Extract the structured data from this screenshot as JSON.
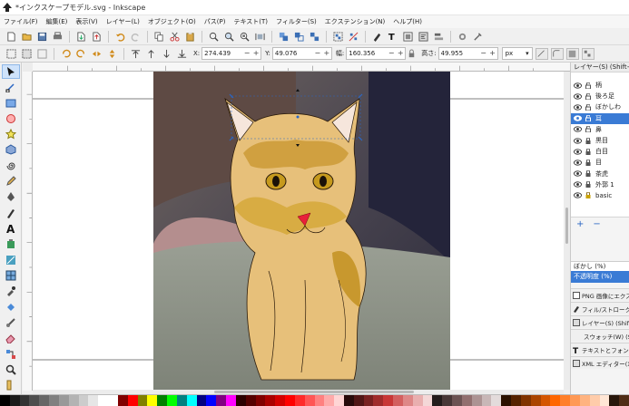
{
  "window": {
    "title": "*インクスケープモデル.svg - Inkscape"
  },
  "menu": [
    "ファイル(F)",
    "編集(E)",
    "表示(V)",
    "レイヤー(L)",
    "オブジェクト(O)",
    "パス(P)",
    "テキスト(T)",
    "フィルター(S)",
    "エクステンション(N)",
    "ヘルプ(H)"
  ],
  "toolbar": {
    "x_label": "X:",
    "x_value": "274.439",
    "y_label": "Y:",
    "y_value": "49.076",
    "w_label": "幅:",
    "w_value": "160.356",
    "h_label": "高さ:",
    "h_value": "49.955",
    "unit": "px"
  },
  "layers_panel": {
    "title": "レイヤー(S) (Shift+Ctrl+L)",
    "layers": [
      {
        "name": "柄",
        "selected": false
      },
      {
        "name": "後ろ足",
        "selected": false
      },
      {
        "name": "ぼかしわ",
        "selected": false
      },
      {
        "name": "耳",
        "selected": true
      },
      {
        "name": "鼻",
        "selected": false
      },
      {
        "name": "黒目",
        "selected": false
      },
      {
        "name": "白目",
        "selected": false
      },
      {
        "name": "目",
        "selected": false
      },
      {
        "name": "茶虎",
        "selected": false
      },
      {
        "name": "外郭 1",
        "selected": false
      },
      {
        "name": "basic",
        "selected": false
      }
    ],
    "add_label": "+",
    "remove_label": "−",
    "blur_label": "ぼかし (%)",
    "opacity_label": "不透明度 (%)"
  },
  "dock_tabs": [
    "PNG 画像にエクスポート",
    "フィル/ストローク(F)",
    "レイヤー(S) (Shift+Ctrl+L)",
    "スウォッチ(W) (Shift+Ctrl+W)",
    "テキストとフォント(T)",
    "XML エディター(X) (Ctrl+Shift+X)"
  ],
  "palette_colors": [
    "#000000",
    "#1a1a1a",
    "#333333",
    "#4d4d4d",
    "#666666",
    "#808080",
    "#999999",
    "#b3b3b3",
    "#cccccc",
    "#e6e6e6",
    "#ffffff",
    "#ffffff",
    "#800000",
    "#ff0000",
    "#808000",
    "#ffff00",
    "#008000",
    "#00ff00",
    "#008080",
    "#00ffff",
    "#000080",
    "#0000ff",
    "#800080",
    "#ff00ff",
    "#2b0000",
    "#550000",
    "#800000",
    "#aa0000",
    "#d40000",
    "#ff0000",
    "#ff2a2a",
    "#ff5555",
    "#ff8080",
    "#ffaaaa",
    "#ffd5d5",
    "#280b0b",
    "#501616",
    "#782121",
    "#a02c2c",
    "#c83737",
    "#d35f5f",
    "#de8787",
    "#e9afaf",
    "#f4d7d7",
    "#241c1c",
    "#483737",
    "#6c5353",
    "#916f6f",
    "#ac9393",
    "#c8b7b7",
    "#e3dbdb",
    "#2b1100",
    "#552200",
    "#803300",
    "#aa4400",
    "#d45500",
    "#ff6600",
    "#ff7f2a",
    "#ff9955",
    "#ffb380",
    "#ffccaa",
    "#ffe6d5",
    "#28170b",
    "#502d16"
  ]
}
